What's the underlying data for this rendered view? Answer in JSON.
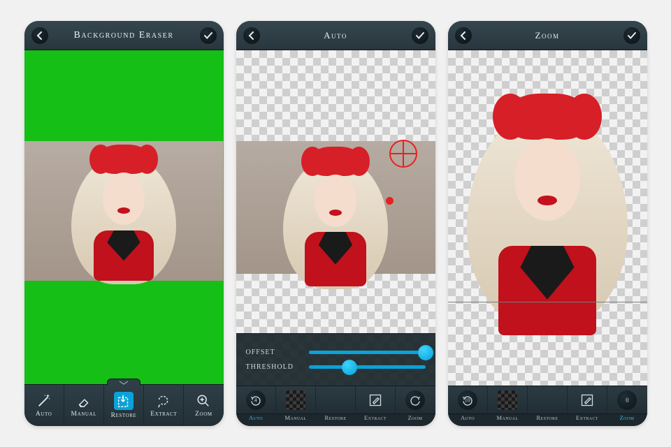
{
  "screen1": {
    "title": "Background Eraser",
    "tools": [
      {
        "label": "Auto"
      },
      {
        "label": "Manual"
      },
      {
        "label": "Restore"
      },
      {
        "label": "Extract"
      },
      {
        "label": "Zoom"
      }
    ]
  },
  "screen2": {
    "title": "Auto",
    "sliders": {
      "offset": {
        "label": "OFFSET",
        "value": 100
      },
      "threshold": {
        "label": "THRESHOLD",
        "value": 35
      }
    },
    "secondary": {
      "undo_count": "4",
      "redo_count": ""
    },
    "mini_tools": [
      "Auto",
      "Manual",
      "Restore",
      "Extract",
      "Zoom"
    ],
    "active_tool_index": 0
  },
  "screen3": {
    "title": "Zoom",
    "secondary": {
      "undo_count": "10",
      "brush_value": "0"
    },
    "mini_tools": [
      "Auto",
      "Manual",
      "Restore",
      "Extract",
      "Zoom"
    ],
    "active_tool_index": 4
  }
}
